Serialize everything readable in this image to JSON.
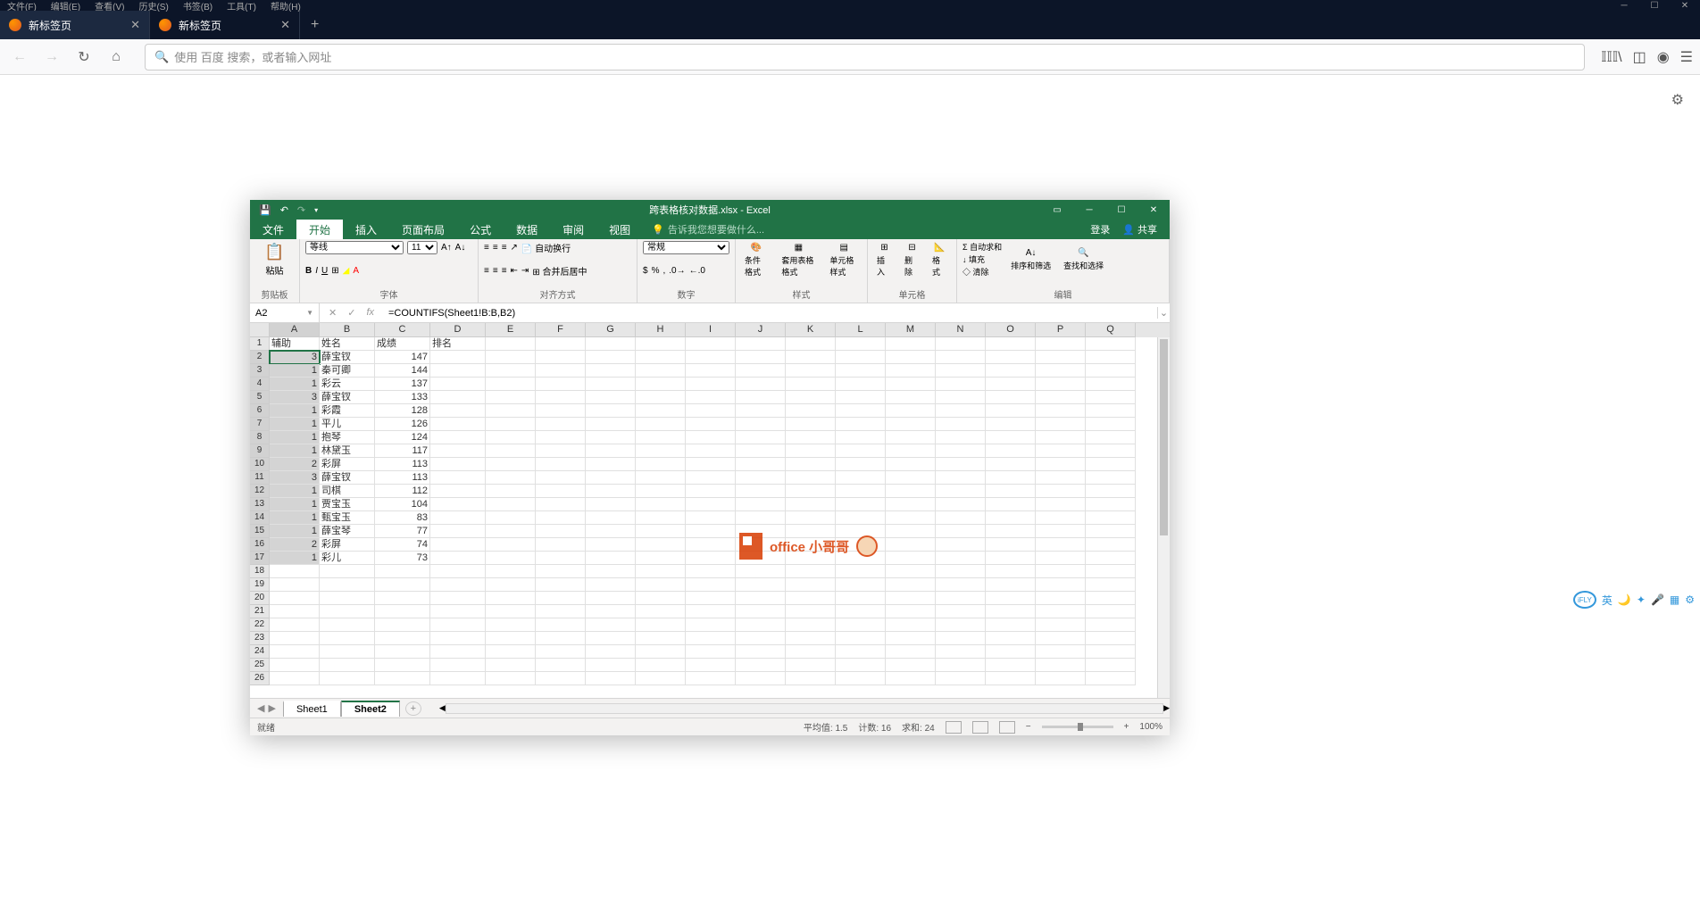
{
  "browser": {
    "menus": [
      "文件(F)",
      "编辑(E)",
      "查看(V)",
      "历史(S)",
      "书签(B)",
      "工具(T)",
      "帮助(H)"
    ],
    "tabs": [
      {
        "title": "新标签页",
        "active": true
      },
      {
        "title": "新标签页",
        "active": false
      }
    ],
    "url_placeholder": "使用 百度 搜索，或者输入网址"
  },
  "excel": {
    "title": "跨表格核对数据.xlsx - Excel",
    "ribbon_tabs": [
      "文件",
      "开始",
      "插入",
      "页面布局",
      "公式",
      "数据",
      "审阅",
      "视图"
    ],
    "active_ribbon": "开始",
    "tell_me": "告诉我您想要做什么...",
    "login": "登录",
    "share": "共享",
    "font_name": "等线",
    "font_size": "11",
    "number_format": "常规",
    "ribbon_groups": {
      "clipboard": "剪贴板",
      "font": "字体",
      "alignment": "对齐方式",
      "number": "数字",
      "styles": "样式",
      "cells": "单元格",
      "editing": "编辑"
    },
    "ribbon_buttons": {
      "paste": "粘贴",
      "wrap": "自动换行",
      "merge": "合并后居中",
      "cond_format": "条件格式",
      "format_table": "套用表格格式",
      "cell_styles": "单元格样式",
      "insert": "插入",
      "delete": "删除",
      "format": "格式",
      "autosum": "自动求和",
      "fill": "填充",
      "clear": "清除",
      "sort_filter": "排序和筛选",
      "find_select": "查找和选择"
    },
    "name_box": "A2",
    "formula": "=COUNTIFS(Sheet1!B:B,B2)",
    "columns": [
      "A",
      "B",
      "C",
      "D",
      "E",
      "F",
      "G",
      "H",
      "I",
      "J",
      "K",
      "L",
      "M",
      "N",
      "O",
      "P",
      "Q"
    ],
    "headers": {
      "a": "辅助",
      "b": "姓名",
      "c": "成绩",
      "d": "排名"
    },
    "rows": [
      {
        "a": "3",
        "b": "薛宝钗",
        "c": "147"
      },
      {
        "a": "1",
        "b": "秦可卿",
        "c": "144"
      },
      {
        "a": "1",
        "b": "彩云",
        "c": "137"
      },
      {
        "a": "3",
        "b": "薛宝钗",
        "c": "133"
      },
      {
        "a": "1",
        "b": "彩霞",
        "c": "128"
      },
      {
        "a": "1",
        "b": "平儿",
        "c": "126"
      },
      {
        "a": "1",
        "b": "抱琴",
        "c": "124"
      },
      {
        "a": "1",
        "b": "林黛玉",
        "c": "117"
      },
      {
        "a": "2",
        "b": "彩屏",
        "c": "113"
      },
      {
        "a": "3",
        "b": "薛宝钗",
        "c": "113"
      },
      {
        "a": "1",
        "b": "司棋",
        "c": "112"
      },
      {
        "a": "1",
        "b": "贾宝玉",
        "c": "104"
      },
      {
        "a": "1",
        "b": "甄宝玉",
        "c": "83"
      },
      {
        "a": "1",
        "b": "薛宝琴",
        "c": "77"
      },
      {
        "a": "2",
        "b": "彩屏",
        "c": "74"
      },
      {
        "a": "1",
        "b": "彩儿",
        "c": "73"
      }
    ],
    "sheets": [
      "Sheet1",
      "Sheet2"
    ],
    "active_sheet": "Sheet2",
    "status": {
      "ready": "就绪",
      "average": "平均值: 1.5",
      "count": "计数: 16",
      "sum": "求和: 24",
      "zoom": "100%"
    }
  },
  "watermark": "office 小哥哥",
  "sidebar": {
    "ifly": "iFLY",
    "lang": "英"
  }
}
